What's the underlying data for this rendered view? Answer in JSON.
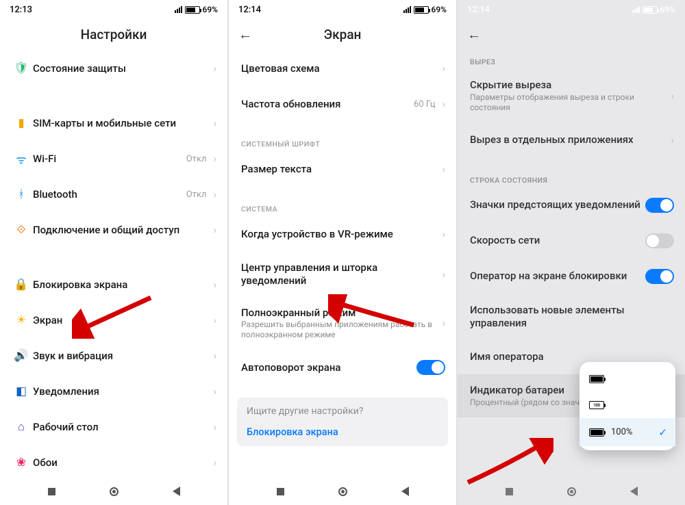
{
  "panel1": {
    "time": "12:13",
    "batt": "69%",
    "title": "Настройки",
    "items": [
      {
        "icon": "🛡",
        "cls": "ic-shield",
        "label": "Состояние защиты",
        "value": ""
      },
      {
        "icon": "▮",
        "cls": "ic-sim",
        "label": "SIM-карты и мобильные сети",
        "value": ""
      },
      {
        "icon": "ᯤ",
        "cls": "ic-wifi",
        "label": "Wi-Fi",
        "value": "Откл"
      },
      {
        "icon": "ᚼ",
        "cls": "ic-bt",
        "label": "Bluetooth",
        "value": "Откл"
      },
      {
        "icon": "⟐",
        "cls": "ic-share",
        "label": "Подключение и общий доступ",
        "value": ""
      },
      {
        "icon": "🔒",
        "cls": "ic-lock",
        "label": "Блокировка экрана",
        "value": ""
      },
      {
        "icon": "☀",
        "cls": "ic-disp",
        "label": "Экран",
        "value": ""
      },
      {
        "icon": "🔊",
        "cls": "ic-sound",
        "label": "Звук и вибрация",
        "value": ""
      },
      {
        "icon": "◧",
        "cls": "ic-notif",
        "label": "Уведомления",
        "value": ""
      },
      {
        "icon": "⌂",
        "cls": "ic-home",
        "label": "Рабочий стол",
        "value": ""
      },
      {
        "icon": "❀",
        "cls": "ic-wall",
        "label": "Обои",
        "value": ""
      }
    ]
  },
  "panel2": {
    "time": "12:14",
    "batt": "69%",
    "title": "Экран",
    "rows": {
      "color_scheme": "Цветовая схема",
      "refresh_rate": "Частота обновления",
      "refresh_val": "60 Гц",
      "sect_font": "СИСТЕМНЫЙ ШРИФТ",
      "text_size": "Размер текста",
      "sect_sys": "СИСТЕМА",
      "vr": "Когда устройство в VR-режиме",
      "ctrl_center": "Центр управления и шторка уведомлений",
      "fullscreen": "Полноэкранный режим",
      "fullscreen_sub": "Разрешить выбранным приложениям работать в полноэкранном режиме",
      "autorotate": "Автоповорот экрана"
    },
    "search_placeholder": "Ищите другие настройки?",
    "search_link": "Блокировка экрана"
  },
  "panel3": {
    "time": "12:14",
    "batt": "69%",
    "sect_cutout": "ВЫРЕЗ",
    "hide_cutout": "Скрытие выреза",
    "hide_cutout_sub": "Параметры отображения выреза и строки состояния",
    "cutout_apps": "Вырез в отдельных приложениях",
    "sect_status": "СТРОКА СОСТОЯНИЯ",
    "notif_icons": "Значки предстоящих уведомлений",
    "net_speed": "Скорость сети",
    "carrier_lock": "Оператор на экране блокировки",
    "new_ctrl": "Использовать новые элементы управления",
    "carrier_name": "Имя оператора",
    "battery_ind": "Индикатор батареи",
    "battery_ind_sub": "Процентный (рядом со значком)",
    "popup_100": "100%"
  }
}
